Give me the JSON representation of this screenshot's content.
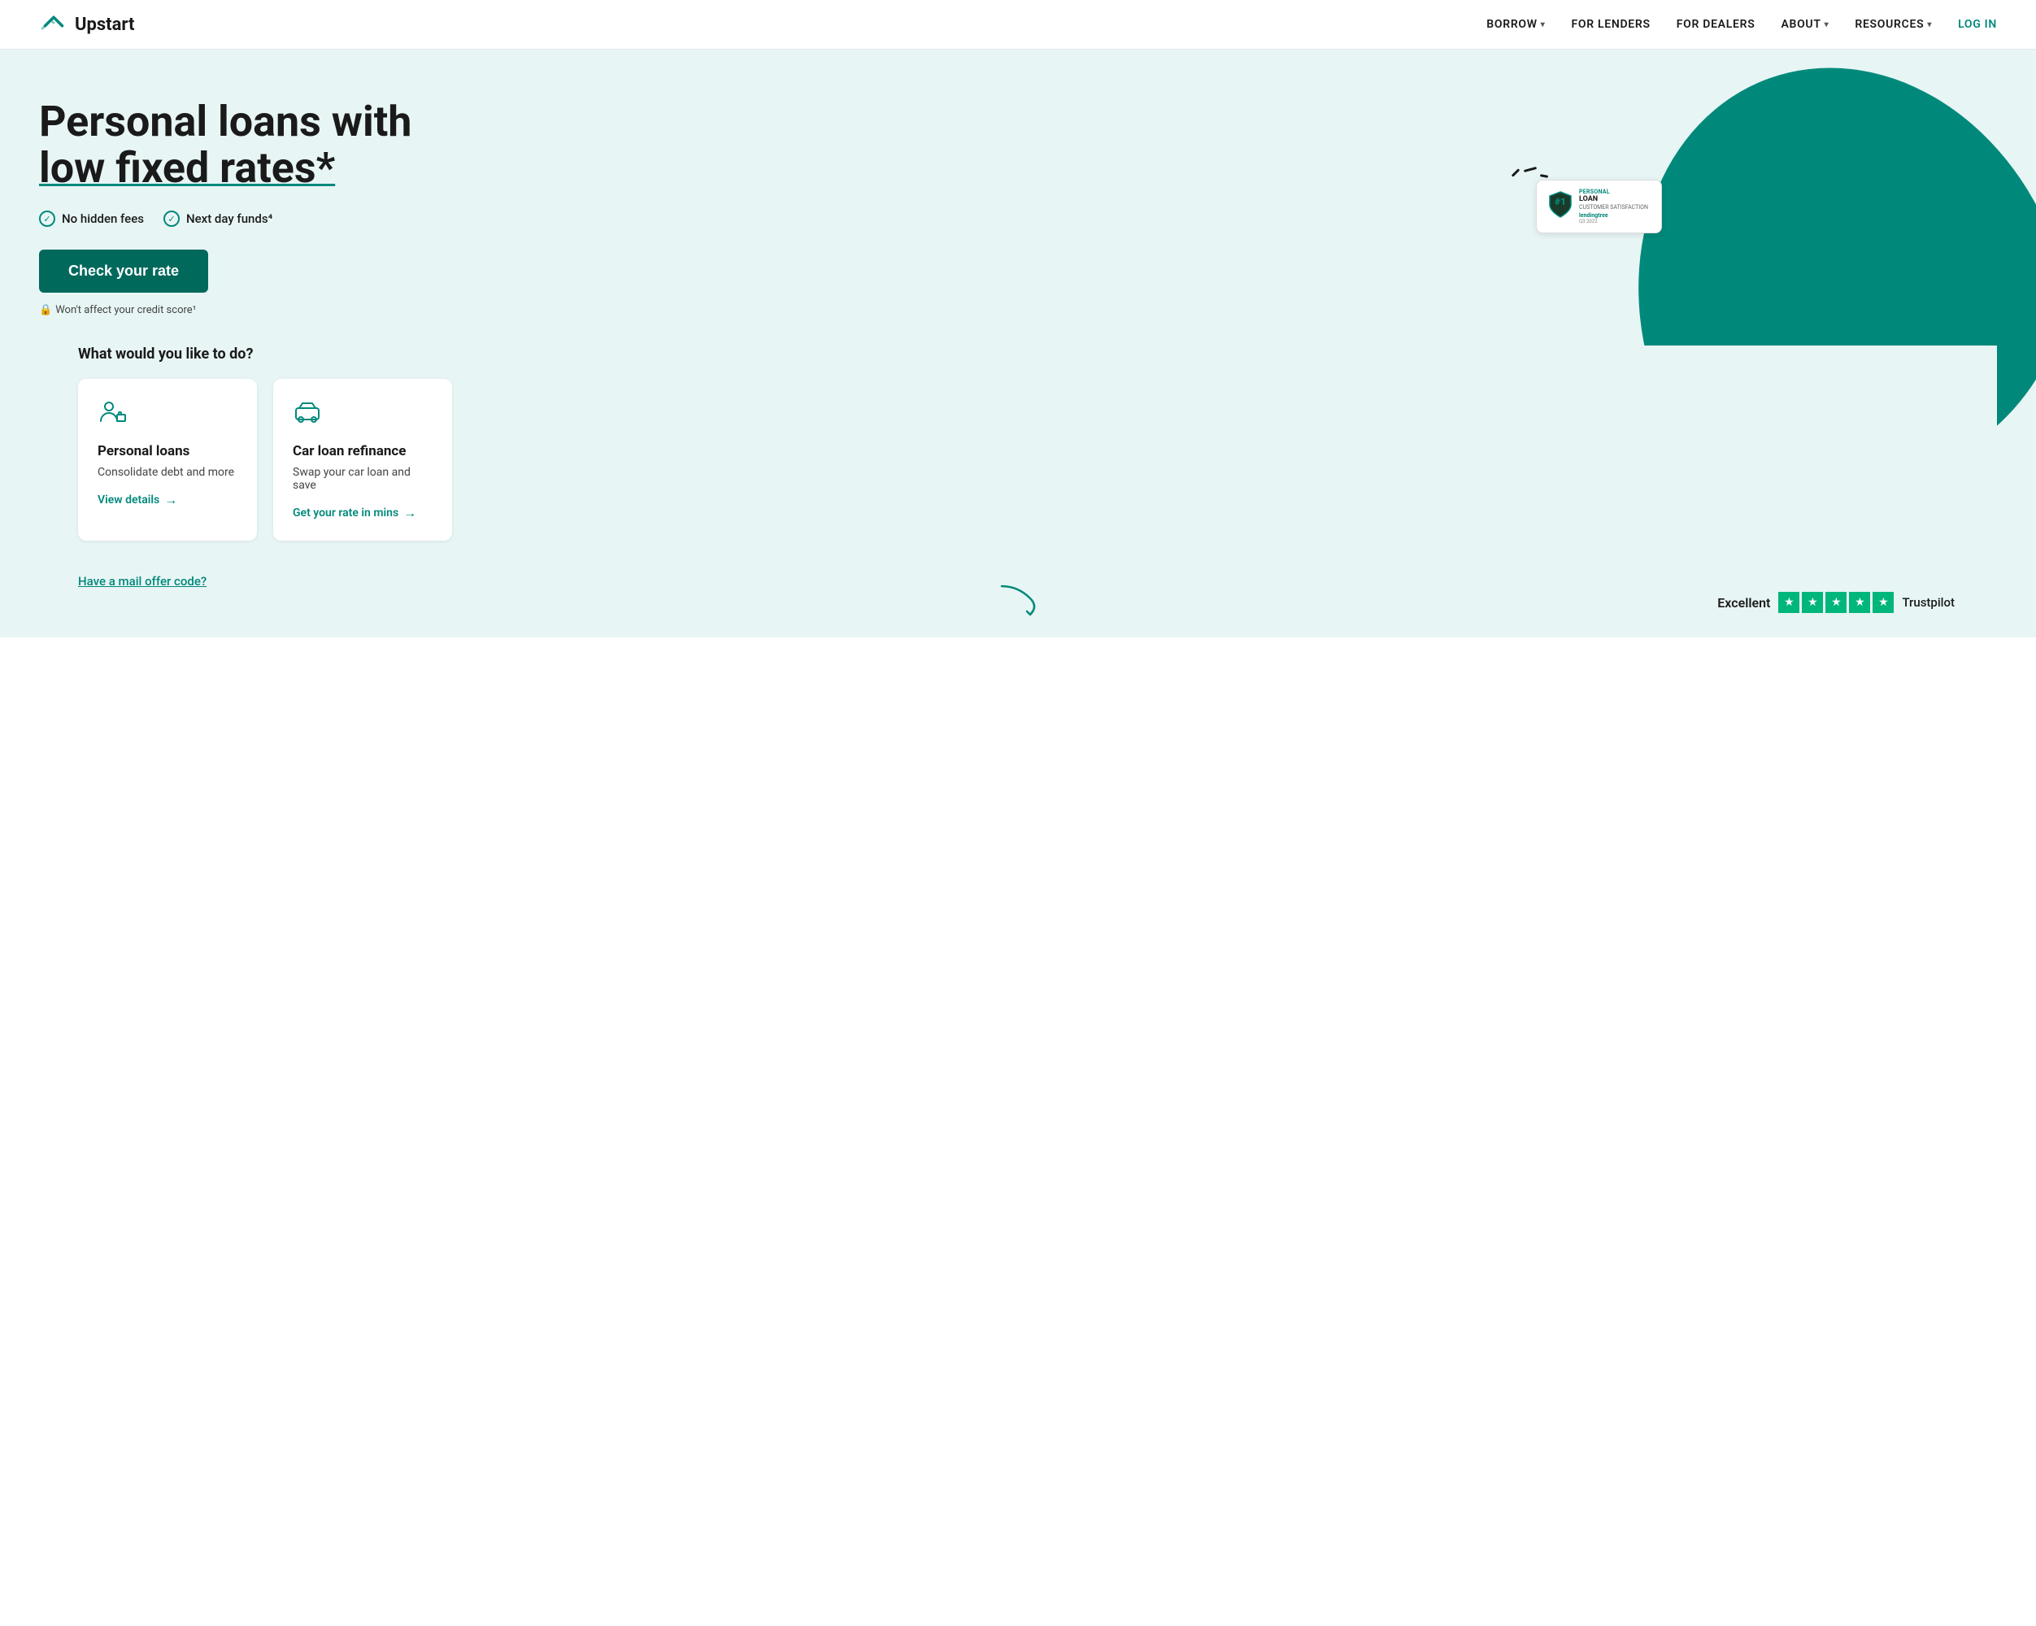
{
  "nav": {
    "logo_text": "Upstart",
    "links": [
      {
        "label": "BORROW",
        "has_caret": true,
        "id": "borrow"
      },
      {
        "label": "FOR LENDERS",
        "has_caret": false,
        "id": "for-lenders"
      },
      {
        "label": "FOR DEALERS",
        "has_caret": false,
        "id": "for-dealers"
      },
      {
        "label": "ABOUT",
        "has_caret": true,
        "id": "about"
      },
      {
        "label": "RESOURCES",
        "has_caret": true,
        "id": "resources"
      },
      {
        "label": "LOG IN",
        "has_caret": false,
        "id": "login",
        "is_login": true
      }
    ]
  },
  "hero": {
    "headline_line1": "Personal loans with",
    "headline_line2": "low fixed rates*",
    "badges": [
      {
        "text": "No hidden fees"
      },
      {
        "text": "Next day funds⁴"
      }
    ],
    "cta_label": "Check your rate",
    "credit_note": "Won't affect your credit score¹"
  },
  "lending_badge": {
    "number": "#1",
    "top_label": "PERSONAL",
    "mid_label": "LOAN",
    "sub_label": "CUSTOMER SATISFACTION",
    "brand": "lendingtree",
    "quarter": "Q3 2022"
  },
  "what_section": {
    "title": "What would you like to do?",
    "cards": [
      {
        "id": "personal-loans",
        "title": "Personal loans",
        "description": "Consolidate debt and more",
        "link_label": "View details"
      },
      {
        "id": "car-loan-refinance",
        "title": "Car loan refinance",
        "description": "Swap your car loan and save",
        "link_label": "Get your rate in mins"
      }
    ]
  },
  "mail_offer": {
    "label": "Have a mail offer code?"
  },
  "trustpilot": {
    "label": "Excellent",
    "brand": "Trustpilot",
    "stars_count": 5
  }
}
